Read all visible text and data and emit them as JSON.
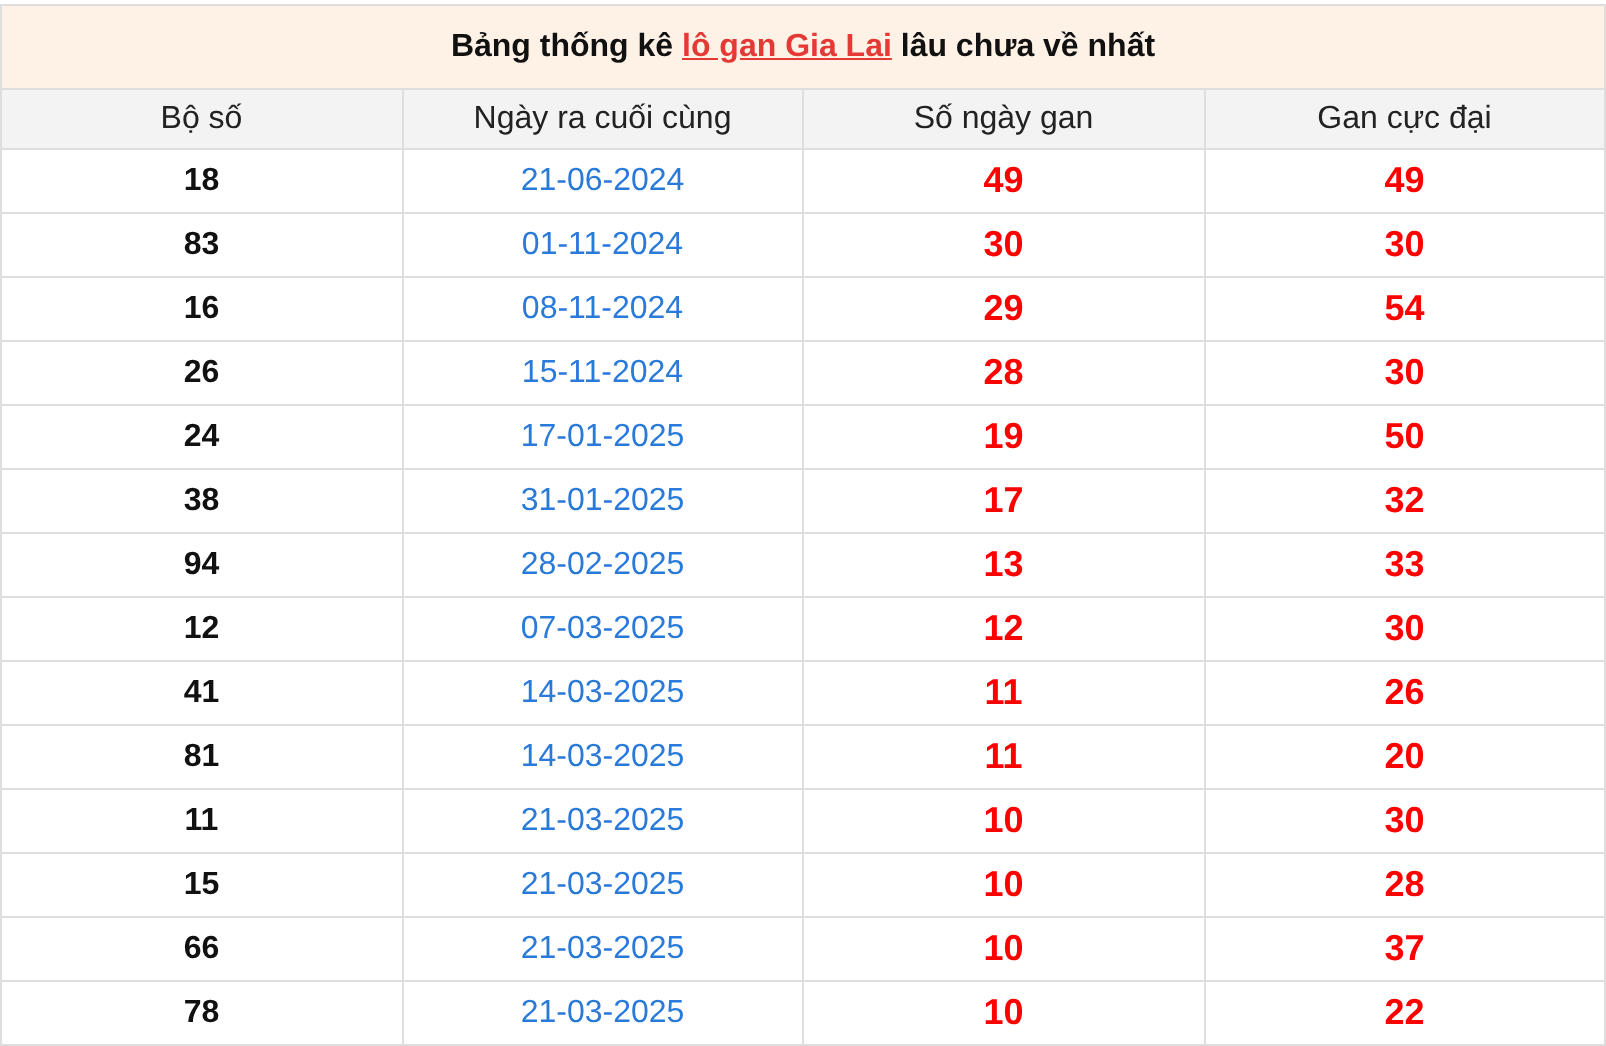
{
  "title": {
    "before": "Bảng thống kê ",
    "link": "lô gan Gia Lai",
    "after": " lâu chưa về nhất"
  },
  "table": {
    "columns": [
      "Bộ số",
      "Ngày ra cuối cùng",
      "Số ngày gan",
      "Gan cực đại"
    ],
    "rows": [
      {
        "number": "18",
        "last_date": "21-06-2024",
        "days": "49",
        "max": "49"
      },
      {
        "number": "83",
        "last_date": "01-11-2024",
        "days": "30",
        "max": "30"
      },
      {
        "number": "16",
        "last_date": "08-11-2024",
        "days": "29",
        "max": "54"
      },
      {
        "number": "26",
        "last_date": "15-11-2024",
        "days": "28",
        "max": "30"
      },
      {
        "number": "24",
        "last_date": "17-01-2025",
        "days": "19",
        "max": "50"
      },
      {
        "number": "38",
        "last_date": "31-01-2025",
        "days": "17",
        "max": "32"
      },
      {
        "number": "94",
        "last_date": "28-02-2025",
        "days": "13",
        "max": "33"
      },
      {
        "number": "12",
        "last_date": "07-03-2025",
        "days": "12",
        "max": "30"
      },
      {
        "number": "41",
        "last_date": "14-03-2025",
        "days": "11",
        "max": "26"
      },
      {
        "number": "81",
        "last_date": "14-03-2025",
        "days": "11",
        "max": "20"
      },
      {
        "number": "11",
        "last_date": "21-03-2025",
        "days": "10",
        "max": "30"
      },
      {
        "number": "15",
        "last_date": "21-03-2025",
        "days": "10",
        "max": "28"
      },
      {
        "number": "66",
        "last_date": "21-03-2025",
        "days": "10",
        "max": "37"
      },
      {
        "number": "78",
        "last_date": "21-03-2025",
        "days": "10",
        "max": "22"
      }
    ]
  }
}
